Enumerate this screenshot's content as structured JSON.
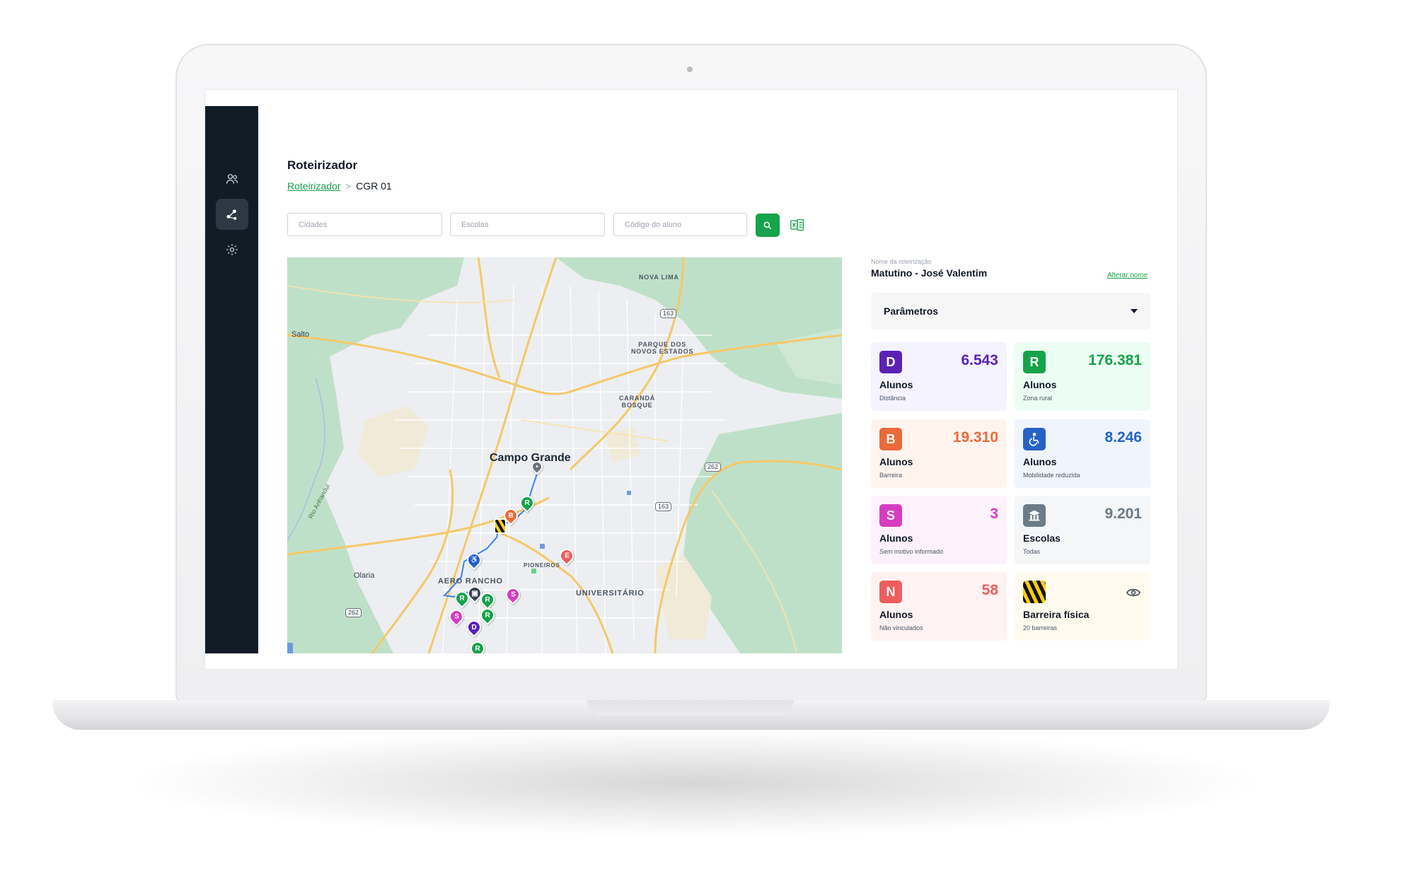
{
  "sidebar": {
    "items": [
      {
        "name": "students",
        "icon": "users-icon"
      },
      {
        "name": "routing",
        "icon": "route-icon",
        "active": true
      },
      {
        "name": "settings",
        "icon": "gear-icon"
      }
    ]
  },
  "header": {
    "title": "Roteirizador",
    "breadcrumb": {
      "link": "Roteirizador",
      "current": "CGR 01"
    }
  },
  "filters": {
    "cities_placeholder": "Cidades",
    "schools_placeholder": "Escolas",
    "student_code_placeholder": "Código do aluno"
  },
  "map": {
    "city": "Campo Grande",
    "labels": {
      "nova_lima": "NOVA LIMA",
      "parque_dos_novos_estados": "PARQUE DOS\nNOVOS ESTADOS",
      "caranda_bosque": "CARANDÁ\nBOSQUE",
      "salto": "Salto",
      "olaria": "Olaria",
      "aero_rancho": "AERO RANCHO",
      "pioneiros": "PIONEIROS",
      "universitario": "UNIVERSITÁRIO",
      "rio_anhandui": "Rio Anhanduí"
    },
    "road_shields": [
      "163",
      "262",
      "163",
      "262"
    ],
    "pins": [
      "R",
      "B",
      "R",
      "R",
      "R",
      "S",
      "S",
      "D",
      "R",
      "R",
      "E"
    ]
  },
  "panel": {
    "route_caption": "Nome da roteirização",
    "route_name": "Matutino - José Valentim",
    "rename_link": "Alterar nome",
    "params_label": "Parâmetros",
    "cards": [
      {
        "badge": "D",
        "value": "6.543",
        "title": "Alunos",
        "subtitle": "Distância",
        "accent": "#5b21b6",
        "bg": "#f5f3ff"
      },
      {
        "badge": "R",
        "value": "176.381",
        "title": "Alunos",
        "subtitle": "Zona rural",
        "accent": "#16a34a",
        "bg": "#ecfdf3"
      },
      {
        "badge": "B",
        "value": "19.310",
        "title": "Alunos",
        "subtitle": "Barreira",
        "accent": "#ea6a3a",
        "bg": "#fff5ee"
      },
      {
        "badge": "wheelchair-icon",
        "value": "8.246",
        "title": "Alunos",
        "subtitle": "Mobilidade reduzida",
        "accent": "#2563c6",
        "bg": "#f0f5fd"
      },
      {
        "badge": "S",
        "value": "3",
        "title": "Alunos",
        "subtitle": "Sem motivo informado",
        "accent": "#d63cc1",
        "bg": "#fdf2fb"
      },
      {
        "badge": "school-icon",
        "value": "9.201",
        "title": "Escolas",
        "subtitle": "Todas",
        "accent": "#6b7c88",
        "bg": "#f4f6f8"
      },
      {
        "badge": "N",
        "value": "58",
        "title": "Alunos",
        "subtitle": "Não vinculados",
        "accent": "#ef5e5e",
        "bg": "#fff2f2"
      },
      {
        "badge": "barrier-icon",
        "value": "",
        "title": "Barreira física",
        "subtitle": "20 barreiras",
        "accent": "#facc15",
        "bg": "#fffcef"
      }
    ]
  }
}
